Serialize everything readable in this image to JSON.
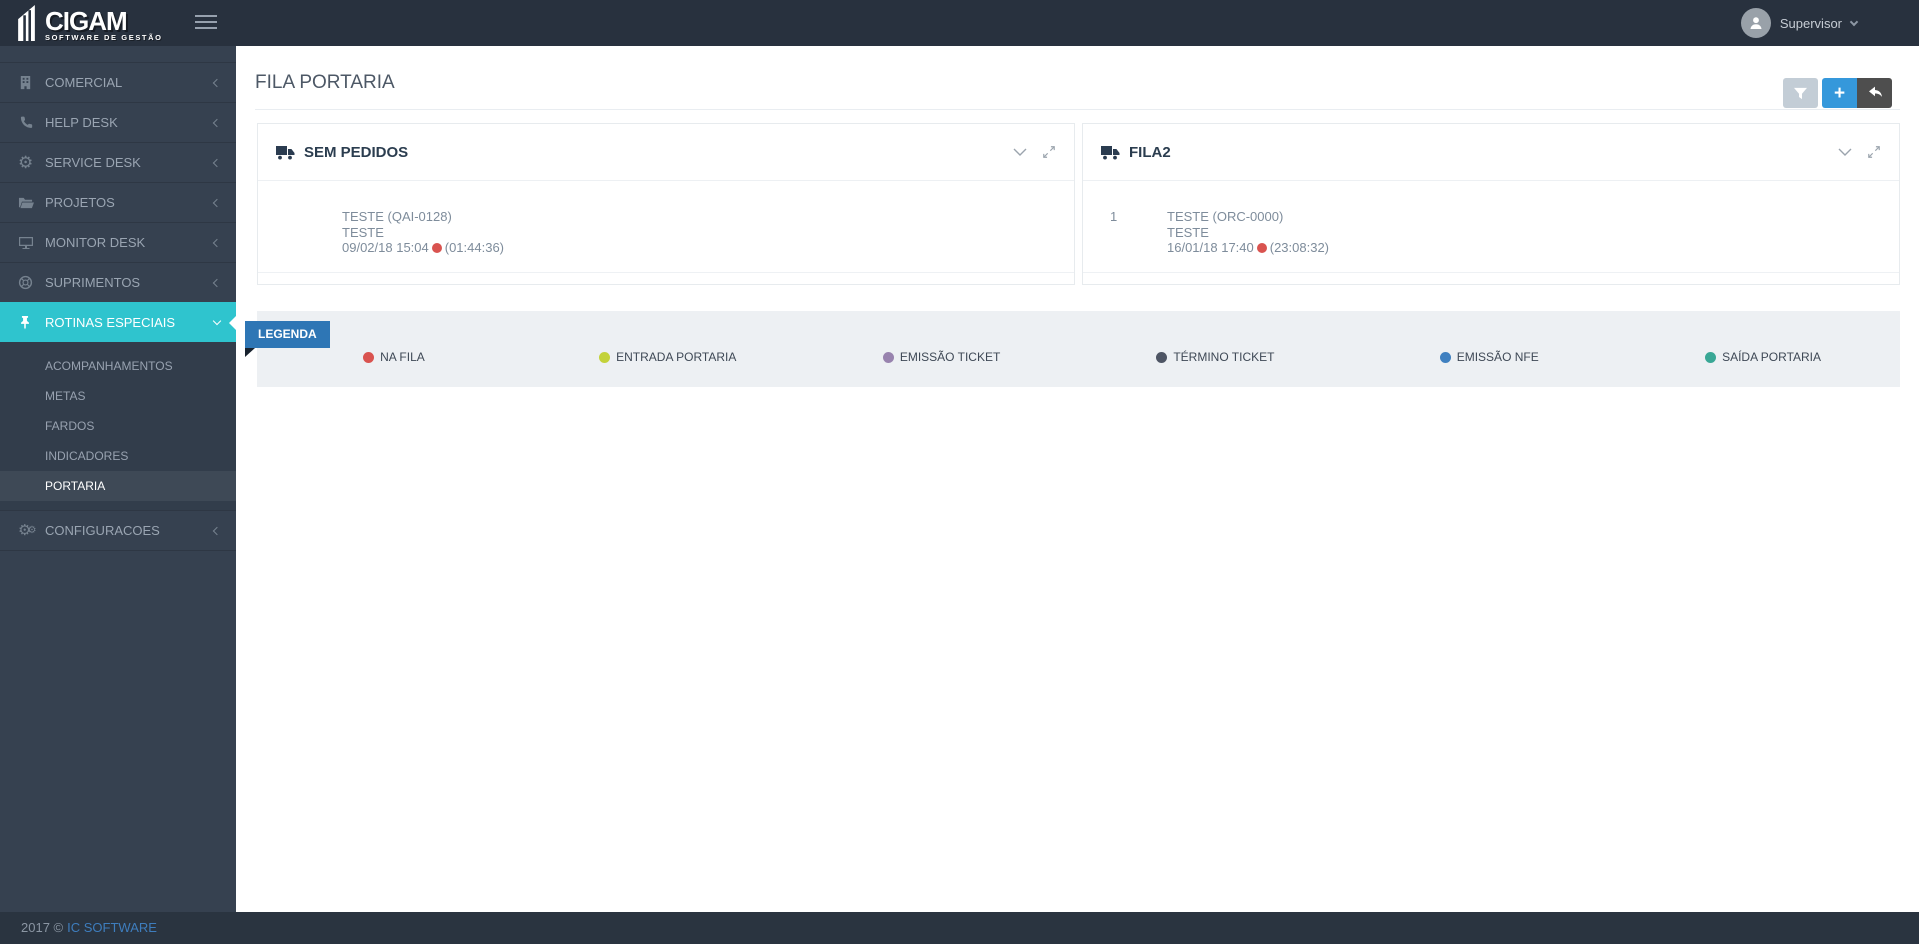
{
  "header": {
    "logo_title": "CIGAM",
    "logo_subtitle": "SOFTWARE DE GESTÃO",
    "user": {
      "name": "Supervisor"
    }
  },
  "sidebar": {
    "items": [
      {
        "label": "COMERCIAL",
        "icon": "building-icon",
        "state": "collapsed"
      },
      {
        "label": "HELP DESK",
        "icon": "phone-icon",
        "state": "collapsed"
      },
      {
        "label": "SERVICE DESK",
        "icon": "gear-icon",
        "state": "collapsed"
      },
      {
        "label": "PROJETOS",
        "icon": "folder-icon",
        "state": "collapsed"
      },
      {
        "label": "MONITOR DESK",
        "icon": "monitor-icon",
        "state": "collapsed"
      },
      {
        "label": "SUPRIMENTOS",
        "icon": "life-ring-icon",
        "state": "collapsed"
      },
      {
        "label": "ROTINAS ESPECIAIS",
        "icon": "pin-icon",
        "state": "expanded",
        "active": true,
        "submenu": [
          {
            "label": "ACOMPANHAMENTOS"
          },
          {
            "label": "METAS"
          },
          {
            "label": "FARDOS"
          },
          {
            "label": "INDICADORES"
          },
          {
            "label": "PORTARIA",
            "active": true
          }
        ]
      },
      {
        "label": "CONFIGURACOES",
        "icon": "gears-icon",
        "state": "collapsed"
      }
    ]
  },
  "page": {
    "title": "FILA PORTARIA"
  },
  "toolbar": {
    "add_label": "+"
  },
  "panels": [
    {
      "title": "SEM PEDIDOS",
      "rows": [
        {
          "position": "",
          "line1": "TESTE (QAI-0128)",
          "line2": "TESTE",
          "datetime": "09/02/18 15:04",
          "duration": "(01:44:36)",
          "status_color": "#d9534f"
        }
      ]
    },
    {
      "title": "FILA2",
      "rows": [
        {
          "position": "1",
          "line1": "TESTE (ORC-0000)",
          "line2": "TESTE",
          "datetime": "16/01/18 17:40",
          "duration": "(23:08:32)",
          "status_color": "#d9534f"
        }
      ]
    }
  ],
  "legend": {
    "title": "LEGENDA",
    "items": [
      {
        "label": "NA FILA",
        "color": "#d9534f"
      },
      {
        "label": "ENTRADA PORTARIA",
        "color": "#c3d23a"
      },
      {
        "label": "EMISSÃO TICKET",
        "color": "#9883ae"
      },
      {
        "label": "TÉRMINO TICKET",
        "color": "#4e5564"
      },
      {
        "label": "EMISSÃO NFE",
        "color": "#3f80c0"
      },
      {
        "label": "SAÍDA PORTARIA",
        "color": "#39a795"
      }
    ]
  },
  "footer": {
    "text": "2017 ©",
    "link": "IC SOFTWARE"
  },
  "colors": {
    "topbar": "#28313e",
    "sidebar": "#364150",
    "accent_teal": "#2fc4ce",
    "ribbon_blue": "#2e76b5",
    "add_button": "#3598db",
    "back_button": "#4e4e4e",
    "filter_button": "#c3cdd6",
    "status_red": "#d9534f"
  }
}
